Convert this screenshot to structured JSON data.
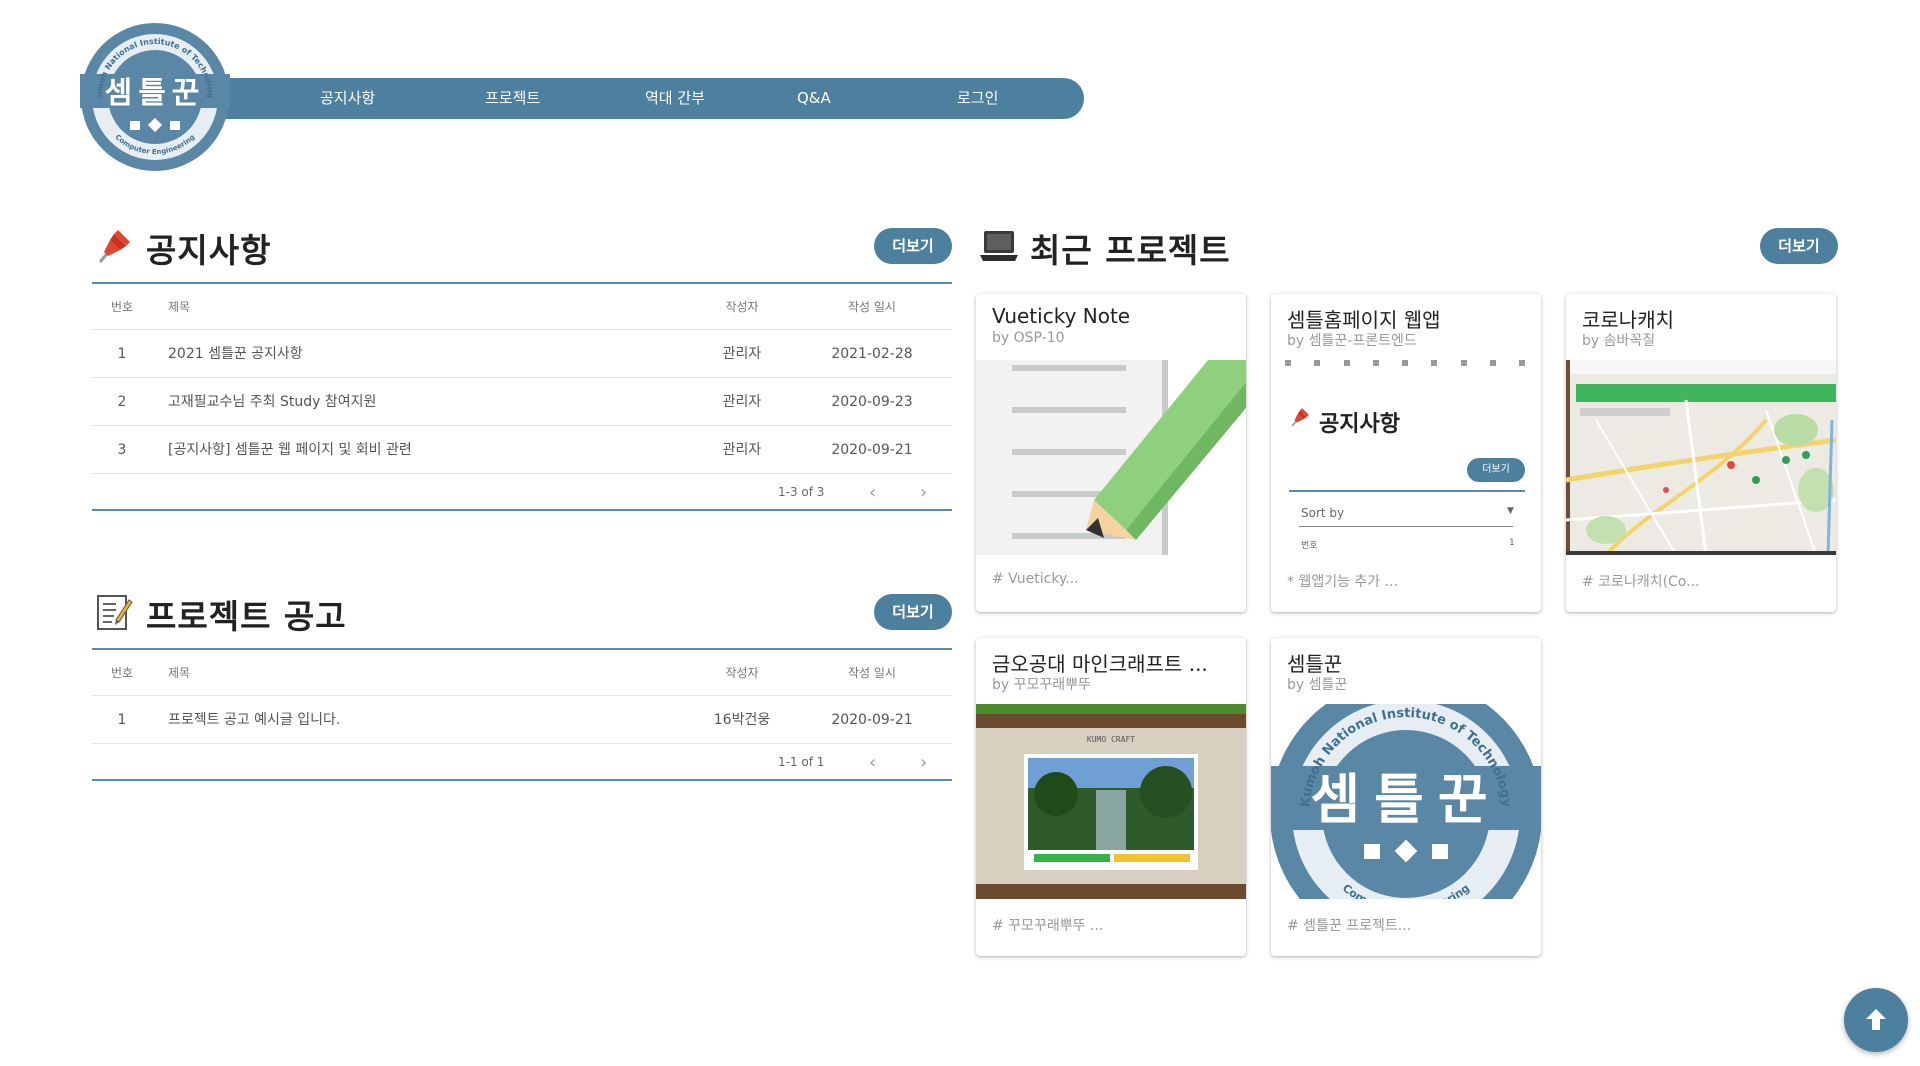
{
  "header": {
    "logo_text": "셈틀꾼",
    "logo_ring_top": "Kumoh National Institute of Technology",
    "logo_ring_bottom": "Computer Engineering",
    "nav": [
      "공지사항",
      "프로젝트",
      "역대 간부",
      "Q&A",
      "로그인"
    ]
  },
  "notices": {
    "title": "공지사항",
    "more_label": "더보기",
    "columns": [
      "번호",
      "제목",
      "작성자",
      "작성 일시"
    ],
    "rows": [
      {
        "no": "1",
        "title": "2021 셈틀꾼 공지사항",
        "author": "관리자",
        "date": "2021-02-28"
      },
      {
        "no": "2",
        "title": "고재필교수님 주최 Study 참여지원",
        "author": "관리자",
        "date": "2020-09-23"
      },
      {
        "no": "3",
        "title": "[공지사항] 셈틀꾼 웹 페이지 및 회비 관련",
        "author": "관리자",
        "date": "2020-09-21"
      }
    ],
    "range": "1-3 of 3"
  },
  "project_ads": {
    "title": "프로젝트 공고",
    "more_label": "더보기",
    "columns": [
      "번호",
      "제목",
      "작성자",
      "작성 일시"
    ],
    "rows": [
      {
        "no": "1",
        "title": "프로젝트 공고 예시글 입니다.",
        "author": "16박건웅",
        "date": "2020-09-21"
      }
    ],
    "range": "1-1 of 1"
  },
  "recent_projects": {
    "title": "최근 프로젝트",
    "more_label": "더보기",
    "cards": [
      {
        "title": "Vueticky Note",
        "by": "by OSP-10",
        "tag": "# Vueticky..."
      },
      {
        "title": "셈틀홈페이지 웹앱",
        "by": "by 셈틀꾼-프론트엔드",
        "tag": "* 웹앱기능 추가 ...",
        "preview": {
          "title": "공지사항",
          "more": "더보기",
          "sort": "Sort by",
          "col": "번호",
          "val": "1"
        }
      },
      {
        "title": "코로나캐치",
        "by": "by 솜바꼭질",
        "tag": "# 코로나캐치(Co..."
      },
      {
        "title": "금오공대 마인크래프트 ...",
        "by": "by 꾸모꾸래뿌뚜",
        "tag": "# 꾸모꾸래뿌뚜 ...",
        "preview": {
          "game": "KUMO CRAFT"
        }
      },
      {
        "title": "셈틀꾼",
        "by": "by 셈틀꾼",
        "tag": "# 셈틀꾼 프로젝트...",
        "preview": {
          "logo_text": "셈틀꾼",
          "ring_top": "Kumoh National Institute of Technology",
          "ring_bottom": "Computer Engineering"
        }
      }
    ]
  },
  "colors": {
    "primary": "#4d7f9e",
    "pin": "#e0452f"
  },
  "icons": [
    "pushpin-icon",
    "laptop-icon",
    "memo-icon",
    "arrow-up-icon"
  ]
}
